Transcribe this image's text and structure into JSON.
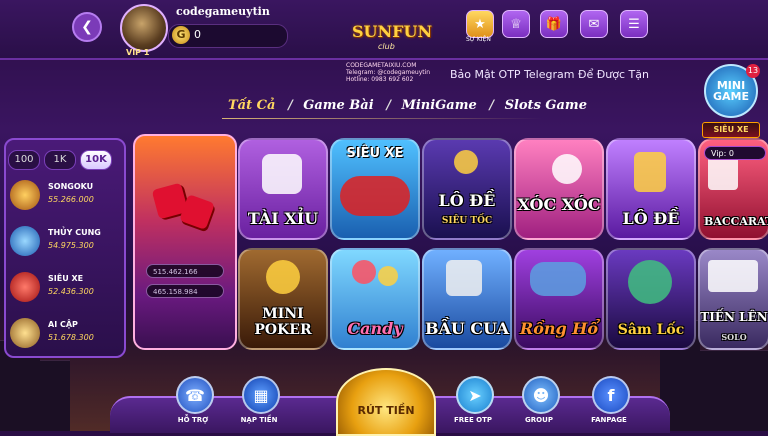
{
  "header": {
    "username": "codegameuytin",
    "vip_label": "VIP 1",
    "coin_symbol": "G",
    "balance": "0",
    "logo_text": "SUNFUN",
    "logo_sub": "club",
    "site_lines": [
      "CODEGAMETAIXIU.COM",
      "Telegram: @codegameuytin",
      "Hotline: 0983 692 602"
    ],
    "marquee": "Bảo Mật OTP Telegram Để Được Tặn",
    "sukien_label": "SỰ KIỆN",
    "icons": [
      "event-icon",
      "vip-crown-icon",
      "gift-icon",
      "mail-icon",
      "menu-icon"
    ]
  },
  "tabs": [
    "Tất Cả",
    "Game Bài",
    "MiniGame",
    "Slots Game"
  ],
  "tab_separator": "/",
  "active_tab": "Tất Cả",
  "jackpot": {
    "filters": [
      "100",
      "1K",
      "10K"
    ],
    "active_filter": "10K",
    "items": [
      {
        "name": "SONGOKU",
        "value": "55.266.000",
        "color": "#e8a020"
      },
      {
        "name": "THỦY CUNG",
        "value": "54.975.300",
        "color": "#3a8ae0"
      },
      {
        "name": "SIÊU XE",
        "value": "52.436.300",
        "color": "#e03030"
      },
      {
        "name": "AI CẬP",
        "value": "51.678.300",
        "color": "#d0a040"
      }
    ]
  },
  "feature": {
    "jp1": "515.462.166",
    "jp2": "465.158.984"
  },
  "games_row1": [
    {
      "label": "TÀI XỈU",
      "top": "",
      "bg": "#8a3ac0"
    },
    {
      "label": "",
      "top": "SIÊU XE",
      "bg": "#30a0e0"
    },
    {
      "label": "LÔ ĐỀ",
      "top": "SIÊU TỐC",
      "bg": "#3a2a90"
    },
    {
      "label": "XÓC XÓC",
      "top": "",
      "bg": "#d040a0"
    },
    {
      "label": "LÔ ĐỀ",
      "top": "",
      "bg": "#9a40d0"
    },
    {
      "label": "BACCARAT",
      "top": "",
      "bg": "#c03050"
    }
  ],
  "games_row2": [
    {
      "label": "MINI POKER",
      "top": "",
      "bg": "#6a3a20"
    },
    {
      "label": "Candy",
      "top": "",
      "bg": "#40b0e0"
    },
    {
      "label": "BẦU CUA",
      "top": "",
      "bg": "#2070c0"
    },
    {
      "label": "Rồng Hổ",
      "top": "",
      "bg": "#6a20a0"
    },
    {
      "label": "Sâm Lốc",
      "top": "",
      "bg": "#3a2080"
    },
    {
      "label": "TIẾN LÊN",
      "top": "",
      "bg": "#6a5a90"
    }
  ],
  "solo_label": "SOLO",
  "mini_game": {
    "label": "MINI GAME",
    "badge": "13",
    "sieu_xe": "SIÊU XE",
    "vip_text": "Vip: 0"
  },
  "bottom": {
    "ho_tro": "HỖ TRỢ",
    "nap_tien": "NẠP TIỀN",
    "rut_tien": "RÚT TIỀN",
    "free_otp": "FREE OTP",
    "group": "GROUP",
    "fanpage": "FANPAGE"
  }
}
